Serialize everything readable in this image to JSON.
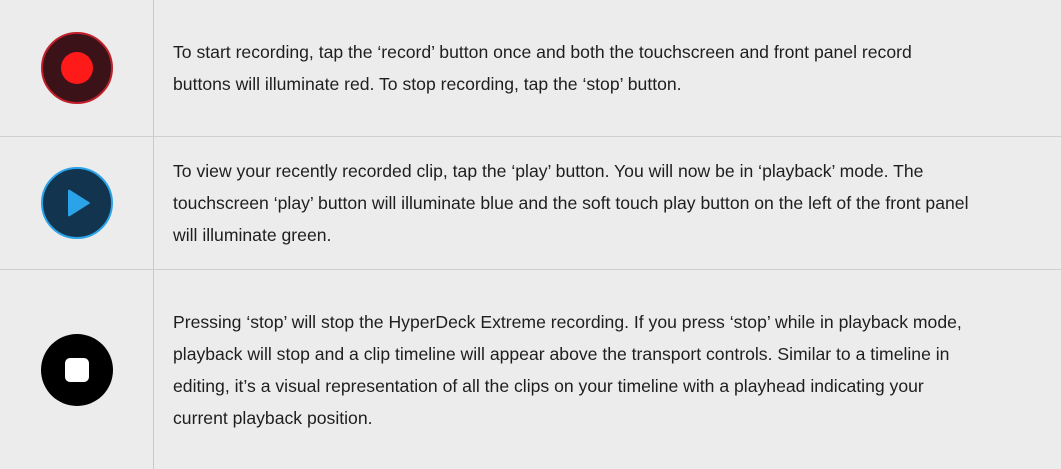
{
  "rows": [
    {
      "icon": "record-icon",
      "text": "To start recording, tap the ‘record’ button once and both the touchscreen and front panel record buttons will illuminate red. To stop recording, tap the ‘stop’ button."
    },
    {
      "icon": "play-icon",
      "text": "To view your recently recorded clip, tap the ‘play’ button. You will now be in ‘playback’ mode. The touchscreen ‘play’ button will illuminate blue and the soft touch play button on the left of the front panel will illuminate green."
    },
    {
      "icon": "stop-icon",
      "text": "Pressing ‘stop’ will stop the HyperDeck Extreme recording. If you press ‘stop’ while in playback mode, playback will stop and a clip timeline will appear above the transport controls. Similar to a timeline in editing, it’s a visual representation of all the clips on your timeline with a playhead indicating your current playback position."
    }
  ],
  "colors": {
    "record_fill": "#ff1a1a",
    "record_ring": "#c0202a",
    "play_fill": "#2ba3e8",
    "stop_fill": "#000000"
  }
}
